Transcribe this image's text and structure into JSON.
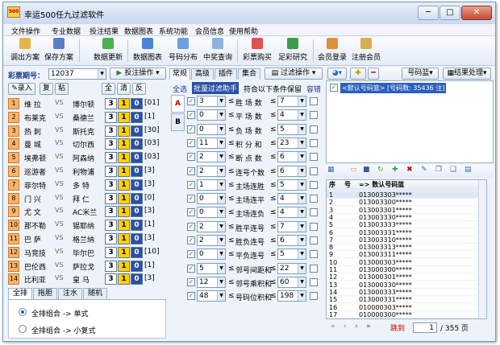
{
  "window": {
    "title": "幸运500任九过滤软件",
    "icon_text": "500",
    "minimize": "─",
    "maximize": "□",
    "close": "✕"
  },
  "menu": [
    "文件操作",
    "专业数据",
    "投注结果",
    "数据图表",
    "系统功能",
    "会员信息",
    "使用帮助"
  ],
  "toolbar": {
    "items": [
      {
        "label": "调出方案",
        "color": "#e7b44a",
        "icon": "folder-icon"
      },
      {
        "label": "保存方案",
        "color": "#5a7fc8",
        "icon": "save-icon"
      },
      {
        "label": "数据更新",
        "color": "#4caf50",
        "icon": "update-icon"
      },
      {
        "label": "数据图表",
        "color": "#4b83d8",
        "icon": "chart-icon"
      },
      {
        "label": "号码分布",
        "color": "#6fa0e0",
        "icon": "grid-icon"
      },
      {
        "label": "中奖查询",
        "color": "#8fb3df",
        "icon": "query-icon"
      },
      {
        "label": "彩票购买",
        "color": "#e15050",
        "icon": "cart-icon"
      },
      {
        "label": "足彩研究",
        "color": "#3a9d4a",
        "icon": "research-icon"
      },
      {
        "label": "会员登录",
        "color": "#e0903a",
        "icon": "user-icon"
      },
      {
        "label": "注册会员",
        "color": "#d7b04a",
        "icon": "register-icon"
      }
    ]
  },
  "left": {
    "issue_label": "彩票期号：",
    "issue_value": "12037",
    "bet_button": "投注操作",
    "buttons": [
      "录入",
      "复",
      "粘",
      "全",
      "清",
      "反"
    ],
    "matches": [
      {
        "no": "1",
        "home": "维 拉",
        "vs": "VS",
        "away": "博尔顿",
        "a": "3",
        "b": "1",
        "c": "0",
        "tag": "[01]"
      },
      {
        "no": "2",
        "home": "布莱克",
        "vs": "VS",
        "away": "桑德兰",
        "a": "3",
        "b": "1",
        "c": "0",
        "tag": "[1]"
      },
      {
        "no": "3",
        "home": "热 刺",
        "vs": "VS",
        "away": "斯托克",
        "a": "3",
        "b": "1",
        "c": "0",
        "tag": "[30]"
      },
      {
        "no": "4",
        "home": "曼 城",
        "vs": "VS",
        "away": "切尔西",
        "a": "3",
        "b": "1",
        "c": "0",
        "tag": "[03]"
      },
      {
        "no": "5",
        "home": "埃弗顿",
        "vs": "VS",
        "away": "阿森纳",
        "a": "3",
        "b": "1",
        "c": "0",
        "tag": "[03]"
      },
      {
        "no": "6",
        "home": "巡游者",
        "vs": "VS",
        "away": "利物浦",
        "a": "3",
        "b": "1",
        "c": "0",
        "tag": "[3]"
      },
      {
        "no": "7",
        "home": "菲尔特",
        "vs": "VS",
        "away": "多 特",
        "a": "3",
        "b": "1",
        "c": "0",
        "tag": "[3]"
      },
      {
        "no": "8",
        "home": "门 兴",
        "vs": "VS",
        "away": "拜 仁",
        "a": "3",
        "b": "1",
        "c": "0",
        "tag": "[0]"
      },
      {
        "no": "9",
        "home": "尤 文",
        "vs": "VS",
        "away": "AC米兰",
        "a": "3",
        "b": "1",
        "c": "0",
        "tag": "[3]"
      },
      {
        "no": "10",
        "home": "那不勒",
        "vs": "VS",
        "away": "锡耶纳",
        "a": "3",
        "b": "1",
        "c": "0",
        "tag": "[1]"
      },
      {
        "no": "11",
        "home": "巴 萨",
        "vs": "VS",
        "away": "格兰纳",
        "a": "3",
        "b": "1",
        "c": "0",
        "tag": "[3]"
      },
      {
        "no": "12",
        "home": "马竞技",
        "vs": "VS",
        "away": "毕尔巴",
        "a": "3",
        "b": "1",
        "c": "0",
        "tag": "[10]"
      },
      {
        "no": "13",
        "home": "巴伦西",
        "vs": "VS",
        "away": "萨拉戈",
        "a": "3",
        "b": "1",
        "c": "0",
        "tag": "[1]"
      },
      {
        "no": "14",
        "home": "比利亚",
        "vs": "VS",
        "away": "皇 马",
        "a": "3",
        "b": "1",
        "c": "0",
        "tag": "[3]"
      }
    ],
    "tabs": [
      "全排",
      "拖胆",
      "注水",
      "随机"
    ],
    "radios": [
      "全排组合 -> 单式",
      "全排组合 -> 小复式"
    ]
  },
  "mid": {
    "tabs": [
      "常规",
      "高级",
      "插件",
      "集合"
    ],
    "filter_button": "过滤操作",
    "sub": {
      "select_all": "全选",
      "batch": "批量过滤助手",
      "cond": "符合以下条件保留",
      "fault": "容错"
    },
    "side_tabs": [
      "A",
      "B"
    ],
    "rows": [
      {
        "min": "3",
        "label": "胜 场 数",
        "max": "7"
      },
      {
        "min": "0",
        "label": "平 场 数",
        "max": "4"
      },
      {
        "min": "0",
        "label": "负 场 数",
        "max": "5"
      },
      {
        "min": "11",
        "label": "积 分 和",
        "max": "23"
      },
      {
        "min": "2",
        "label": "断 点 数",
        "max": "6"
      },
      {
        "min": "2",
        "label": "连号个数",
        "max": "6"
      },
      {
        "min": "1",
        "label": "主场连胜",
        "max": "5"
      },
      {
        "min": "0",
        "label": "主场连平",
        "max": "4"
      },
      {
        "min": "0",
        "label": "主场连负",
        "max": "4"
      },
      {
        "min": "2",
        "label": "胜平连号",
        "max": "7"
      },
      {
        "min": "2",
        "label": "胜负连号",
        "max": "6"
      },
      {
        "min": "0",
        "label": "平负连号",
        "max": "5"
      },
      {
        "min": "5",
        "label": "邻号间距和",
        "max": "22"
      },
      {
        "min": "12",
        "label": "邻号乘积和",
        "max": "60"
      },
      {
        "min": "48",
        "label": "号码位积和",
        "max": "198"
      }
    ]
  },
  "right": {
    "tree_item": "<默认号码篮> [号码数: 35436 注]",
    "basket_btn": "号码篮",
    "result_btn": "结果处理",
    "grid_header": [
      "序",
      "号",
      "=> 数认号码篮"
    ],
    "grid_rows": [
      {
        "n": "1",
        "v": "013003303*****"
      },
      {
        "n": "2",
        "v": "013003300*****"
      },
      {
        "n": "3",
        "v": "013003301*****"
      },
      {
        "n": "4",
        "v": "013003330*****"
      },
      {
        "n": "5",
        "v": "013003333*****"
      },
      {
        "n": "6",
        "v": "013003331*****"
      },
      {
        "n": "7",
        "v": "013003310*****"
      },
      {
        "n": "8",
        "v": "013003313*****"
      },
      {
        "n": "9",
        "v": "013003311*****"
      },
      {
        "n": "10",
        "v": "013000303*****"
      },
      {
        "n": "11",
        "v": "013000300*****"
      },
      {
        "n": "12",
        "v": "013000301*****"
      },
      {
        "n": "13",
        "v": "013000330*****"
      },
      {
        "n": "14",
        "v": "013000333*****"
      },
      {
        "n": "15",
        "v": "013000331*****"
      },
      {
        "n": "16",
        "v": "010000303*****"
      },
      {
        "n": "17",
        "v": "010000300*****"
      }
    ],
    "nav": {
      "jump": "跳到",
      "page": "1",
      "total": "/ 355 页"
    }
  }
}
